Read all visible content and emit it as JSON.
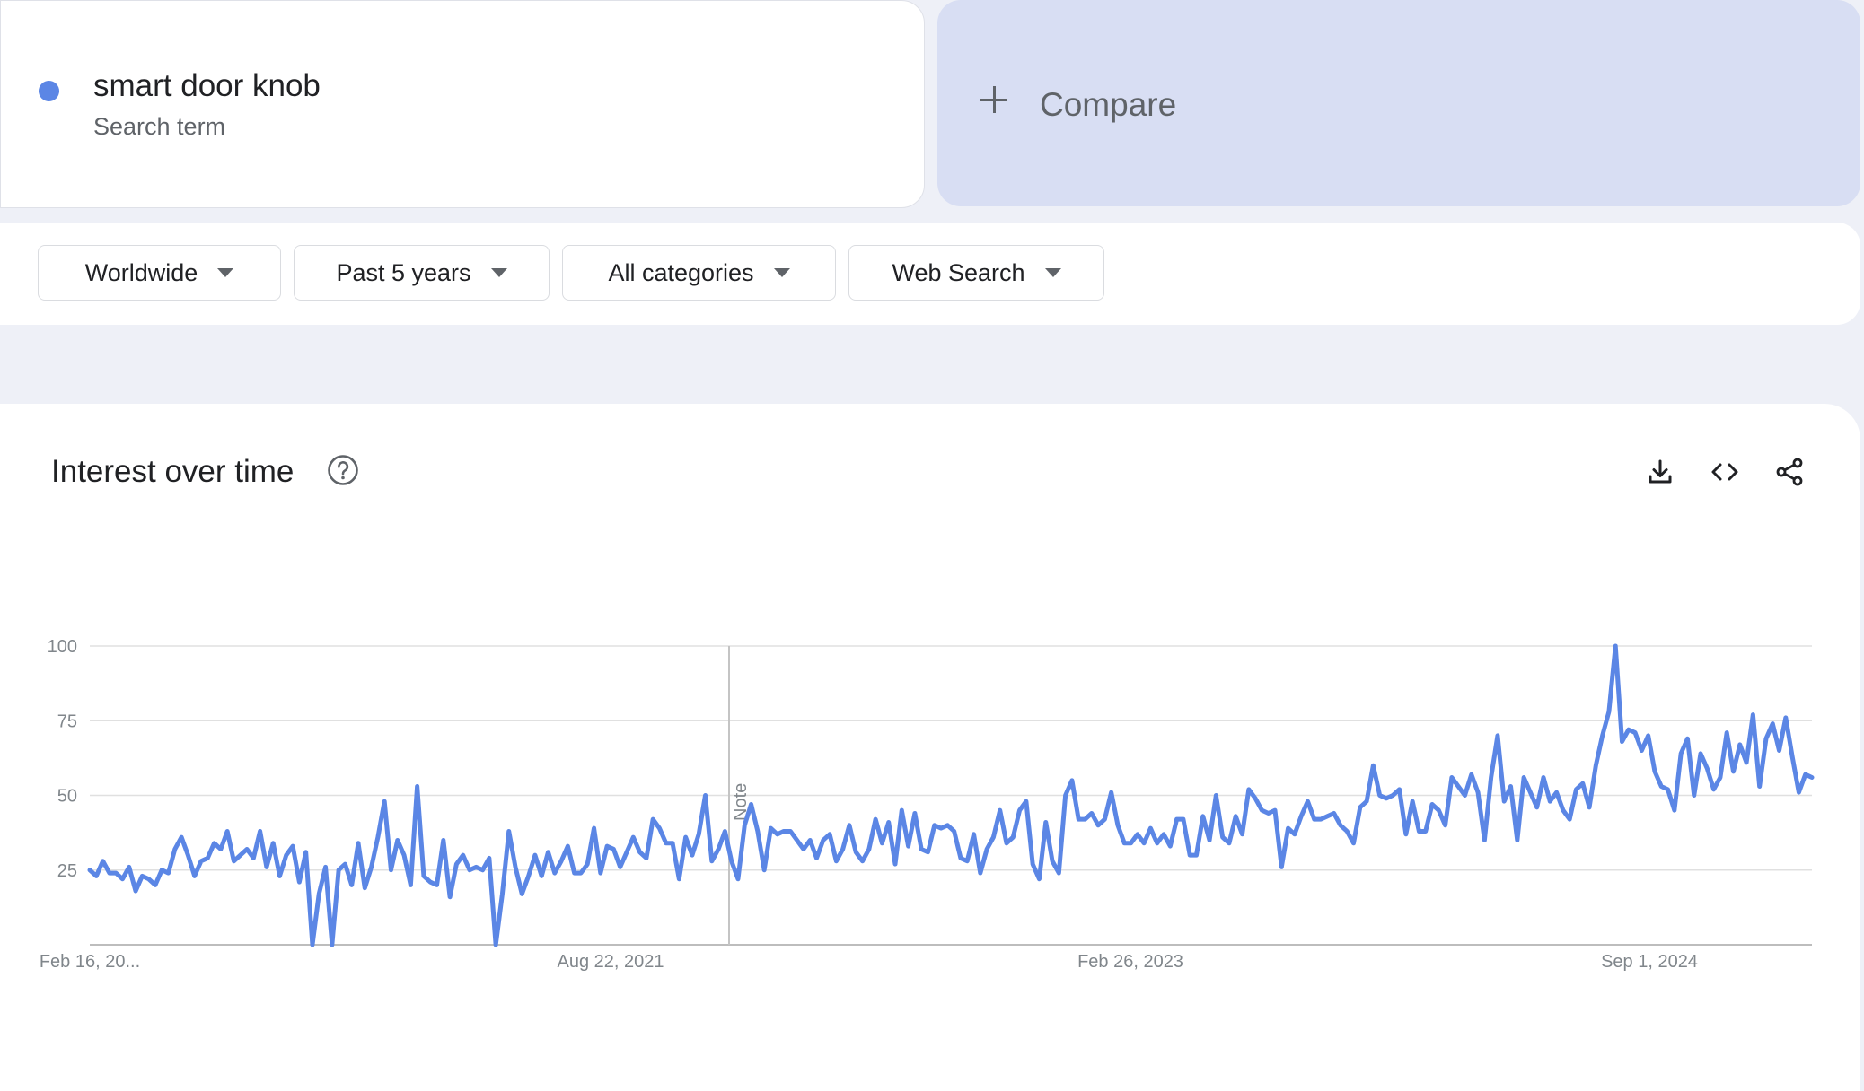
{
  "search_term": {
    "name": "smart door knob",
    "subtitle": "Search term",
    "color": "#5b86e5"
  },
  "compare": {
    "label": "Compare"
  },
  "filters": [
    {
      "label": "Worldwide"
    },
    {
      "label": "Past 5 years"
    },
    {
      "label": "All categories"
    },
    {
      "label": "Web Search"
    }
  ],
  "panel": {
    "title": "Interest over time",
    "help_icon": "question-circle-icon",
    "tools": [
      "download-icon",
      "embed-code-icon",
      "share-icon"
    ]
  },
  "chart_data": {
    "type": "line",
    "ylim": [
      0,
      100
    ],
    "yticks": [
      "100",
      "75",
      "50",
      "25"
    ],
    "xticks": [
      "Feb 16, 20...",
      "Aug 22, 2021",
      "Feb 26, 2023",
      "Sep 1, 2024"
    ],
    "note_label": "Note",
    "grid": true,
    "series": [
      {
        "color": "#5b86e5",
        "values": [
          25,
          23,
          28,
          24,
          24,
          22,
          26,
          18,
          23,
          22,
          20,
          25,
          24,
          32,
          36,
          30,
          23,
          28,
          29,
          34,
          32,
          38,
          28,
          30,
          32,
          29,
          38,
          26,
          34,
          23,
          30,
          33,
          21,
          31,
          0,
          17,
          26,
          0,
          25,
          27,
          20,
          34,
          19,
          26,
          36,
          48,
          25,
          35,
          30,
          20,
          53,
          23,
          21,
          20,
          35,
          16,
          27,
          30,
          25,
          26,
          25,
          29,
          0,
          17,
          38,
          26,
          17,
          23,
          30,
          23,
          31,
          24,
          28,
          33,
          24,
          24,
          27,
          39,
          24,
          33,
          32,
          26,
          31,
          36,
          31,
          29,
          42,
          39,
          34,
          34,
          22,
          36,
          30,
          37,
          50,
          28,
          32,
          38,
          28,
          22,
          40,
          47,
          38,
          25,
          39,
          37,
          38,
          38,
          35,
          32,
          35,
          29,
          35,
          37,
          28,
          32,
          40,
          31,
          28,
          32,
          42,
          34,
          41,
          27,
          45,
          33,
          44,
          32,
          31,
          40,
          39,
          40,
          38,
          29,
          28,
          37,
          24,
          32,
          36,
          45,
          34,
          36,
          45,
          48,
          27,
          22,
          41,
          28,
          24,
          50,
          55,
          42,
          42,
          44,
          40,
          42,
          51,
          40,
          34,
          34,
          37,
          34,
          39,
          34,
          37,
          33,
          42,
          42,
          30,
          30,
          43,
          35,
          50,
          36,
          34,
          43,
          37,
          52,
          49,
          45,
          44,
          45,
          26,
          39,
          37,
          43,
          48,
          42,
          42,
          43,
          44,
          40,
          38,
          34,
          46,
          48,
          60,
          50,
          49,
          50,
          52,
          37,
          48,
          38,
          38,
          47,
          45,
          40,
          56,
          53,
          50,
          57,
          51,
          35,
          56,
          70,
          48,
          53,
          35,
          56,
          51,
          46,
          56,
          48,
          51,
          45,
          42,
          52,
          54,
          46,
          60,
          70,
          78,
          100,
          68,
          72,
          71,
          65,
          70,
          58,
          53,
          52,
          45,
          64,
          69,
          50,
          64,
          59,
          52,
          56,
          71,
          58,
          67,
          61,
          77,
          53,
          69,
          74,
          65,
          76,
          63,
          51,
          57,
          56
        ]
      }
    ]
  }
}
